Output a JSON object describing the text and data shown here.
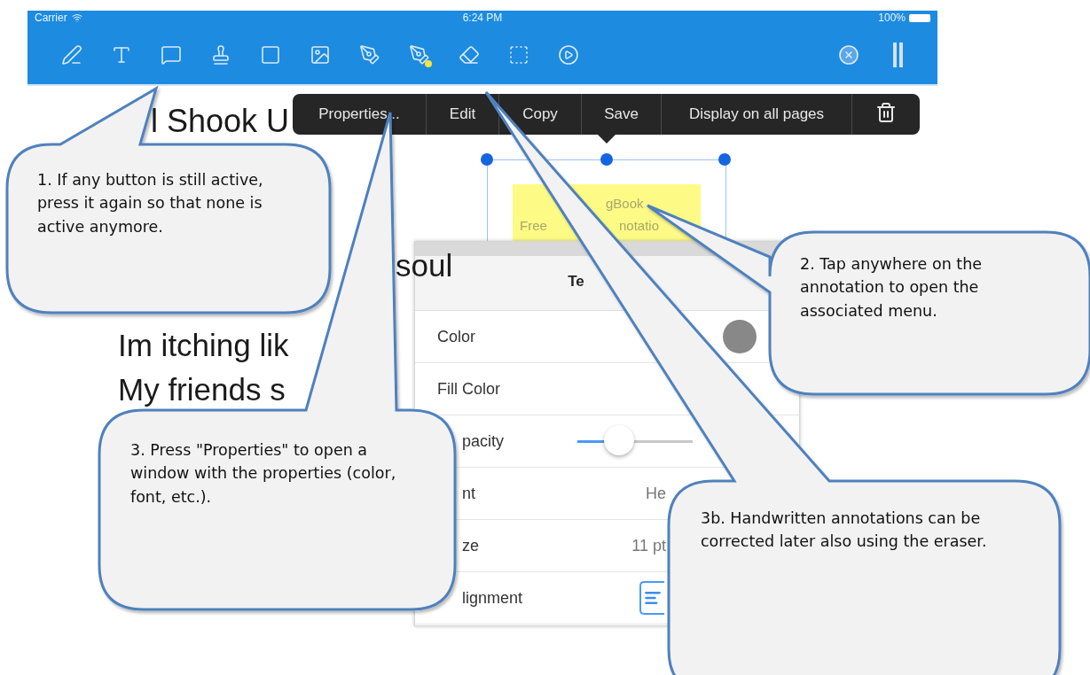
{
  "status_bar": {
    "carrier": "Carrier",
    "time": "6:24 PM",
    "battery": "100%"
  },
  "document": {
    "fragments": [
      {
        "kind": "title",
        "text": "l Shook U"
      },
      {
        "kind": "line",
        "text": "soul"
      },
      {
        "kind": "line",
        "text": "Im itching lik"
      },
      {
        "kind": "line",
        "text": "My friends s"
      }
    ]
  },
  "context_menu": {
    "items": [
      "Properties...",
      "Edit",
      "Copy",
      "Save",
      "Display on all pages"
    ]
  },
  "note": {
    "fragments": [
      "gBook",
      "Free",
      "notatio"
    ]
  },
  "properties_panel": {
    "title": "Te",
    "rows": [
      {
        "kind": "color",
        "label": "Color",
        "color": "#888888"
      },
      {
        "kind": "label",
        "label": "Fill Color"
      },
      {
        "kind": "slider",
        "label": "pacity",
        "level": 0.36
      },
      {
        "kind": "value",
        "label": "nt",
        "value": "He"
      },
      {
        "kind": "value",
        "label": "ze",
        "value": "11 pt"
      },
      {
        "kind": "alignment",
        "label": "lignment"
      }
    ]
  },
  "callouts": [
    "1. If any button is still active, press it again so that none is active anymore.",
    "3. Press \"Properties\" to open a window with the properties (color, font, etc.).",
    "2. Tap anywhere on the annotation to open the associated menu.",
    "3b. Handwritten annotations can be corrected later also using the eraser."
  ]
}
